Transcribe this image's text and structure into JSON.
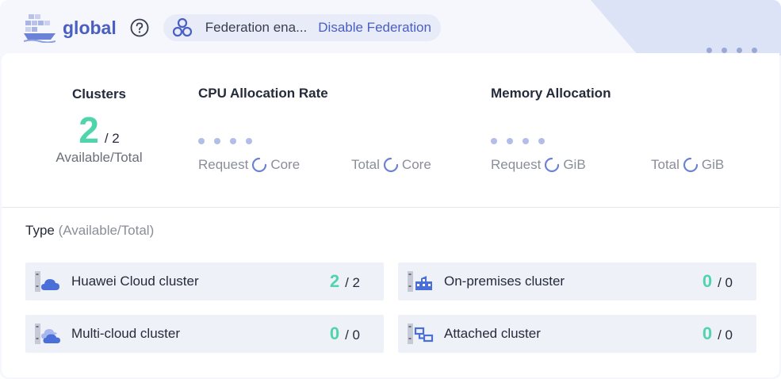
{
  "header": {
    "title": "global",
    "federation_status": "Federation ena...",
    "federation_action": "Disable Federation"
  },
  "summary": {
    "clusters": {
      "label": "Clusters",
      "available": "2",
      "total": "/ 2",
      "caption": "Available/Total"
    },
    "cpu": {
      "label": "CPU Allocation Rate",
      "request_label": "Request",
      "request_unit": "Core",
      "total_label": "Total",
      "total_unit": "Core"
    },
    "memory": {
      "label": "Memory Allocation",
      "request_label": "Request",
      "request_unit": "GiB",
      "total_label": "Total",
      "total_unit": "GiB"
    }
  },
  "types": {
    "label": "Type",
    "sublabel": "(Available/Total)",
    "items": [
      {
        "name": "Huawei Cloud cluster",
        "available": "2",
        "total": "/ 2",
        "icon": "huawei-cloud-icon"
      },
      {
        "name": "On-premises cluster",
        "available": "0",
        "total": "/ 0",
        "icon": "on-premises-icon"
      },
      {
        "name": "Multi-cloud cluster",
        "available": "0",
        "total": "/ 0",
        "icon": "multi-cloud-icon"
      },
      {
        "name": "Attached cluster",
        "available": "0",
        "total": "/ 0",
        "icon": "attached-cluster-icon"
      }
    ]
  },
  "colors": {
    "accent": "#4a5fc1",
    "available": "#50d4ab",
    "background": "#f5f7fd"
  }
}
